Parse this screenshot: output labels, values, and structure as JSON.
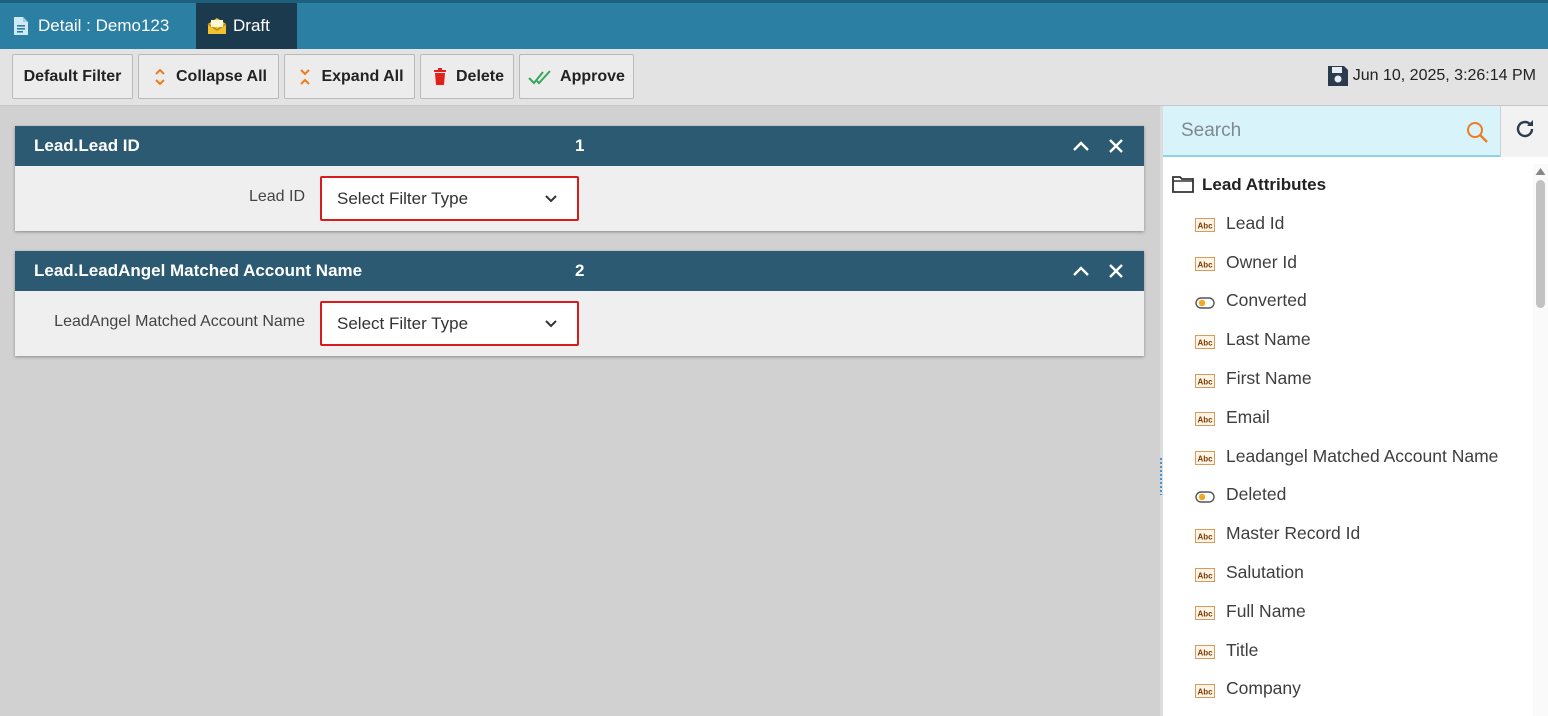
{
  "tabs": [
    {
      "label": "Detail : Demo123",
      "icon": "document-icon"
    },
    {
      "label": "Draft",
      "icon": "envelope-open-icon"
    }
  ],
  "toolbar": {
    "default_filter": "Default Filter",
    "collapse_all": "Collapse All",
    "expand_all": "Expand All",
    "delete": "Delete",
    "approve": "Approve",
    "saved_time": "Jun 10, 2025, 3:26:14 PM"
  },
  "filters": [
    {
      "title": "Lead.Lead ID",
      "number": "1",
      "label": "Lead ID",
      "select_value": "Select Filter Type"
    },
    {
      "title": "Lead.LeadAngel Matched Account Name",
      "number": "2",
      "label": "LeadAngel Matched Account Name",
      "select_value": "Select Filter Type"
    }
  ],
  "search": {
    "placeholder": "Search"
  },
  "tree": {
    "group_label": "Lead Attributes",
    "items": [
      {
        "label": "Lead Id",
        "type": "text"
      },
      {
        "label": "Owner Id",
        "type": "text"
      },
      {
        "label": "Converted",
        "type": "boolean"
      },
      {
        "label": "Last Name",
        "type": "text"
      },
      {
        "label": "First Name",
        "type": "text"
      },
      {
        "label": "Email",
        "type": "text"
      },
      {
        "label": "Leadangel Matched Account Name",
        "type": "text"
      },
      {
        "label": "Deleted",
        "type": "boolean"
      },
      {
        "label": "Master Record Id",
        "type": "text"
      },
      {
        "label": "Salutation",
        "type": "text"
      },
      {
        "label": "Full Name",
        "type": "text"
      },
      {
        "label": "Title",
        "type": "text"
      },
      {
        "label": "Company",
        "type": "text"
      }
    ]
  },
  "colors": {
    "titlebar": "#2a7fa3",
    "active_tab": "#1b3a4d",
    "panel_header": "#2b5a72",
    "select_border": "#d81b1b",
    "search_bg": "#d9f3fb",
    "accent_orange": "#f07a1e"
  }
}
